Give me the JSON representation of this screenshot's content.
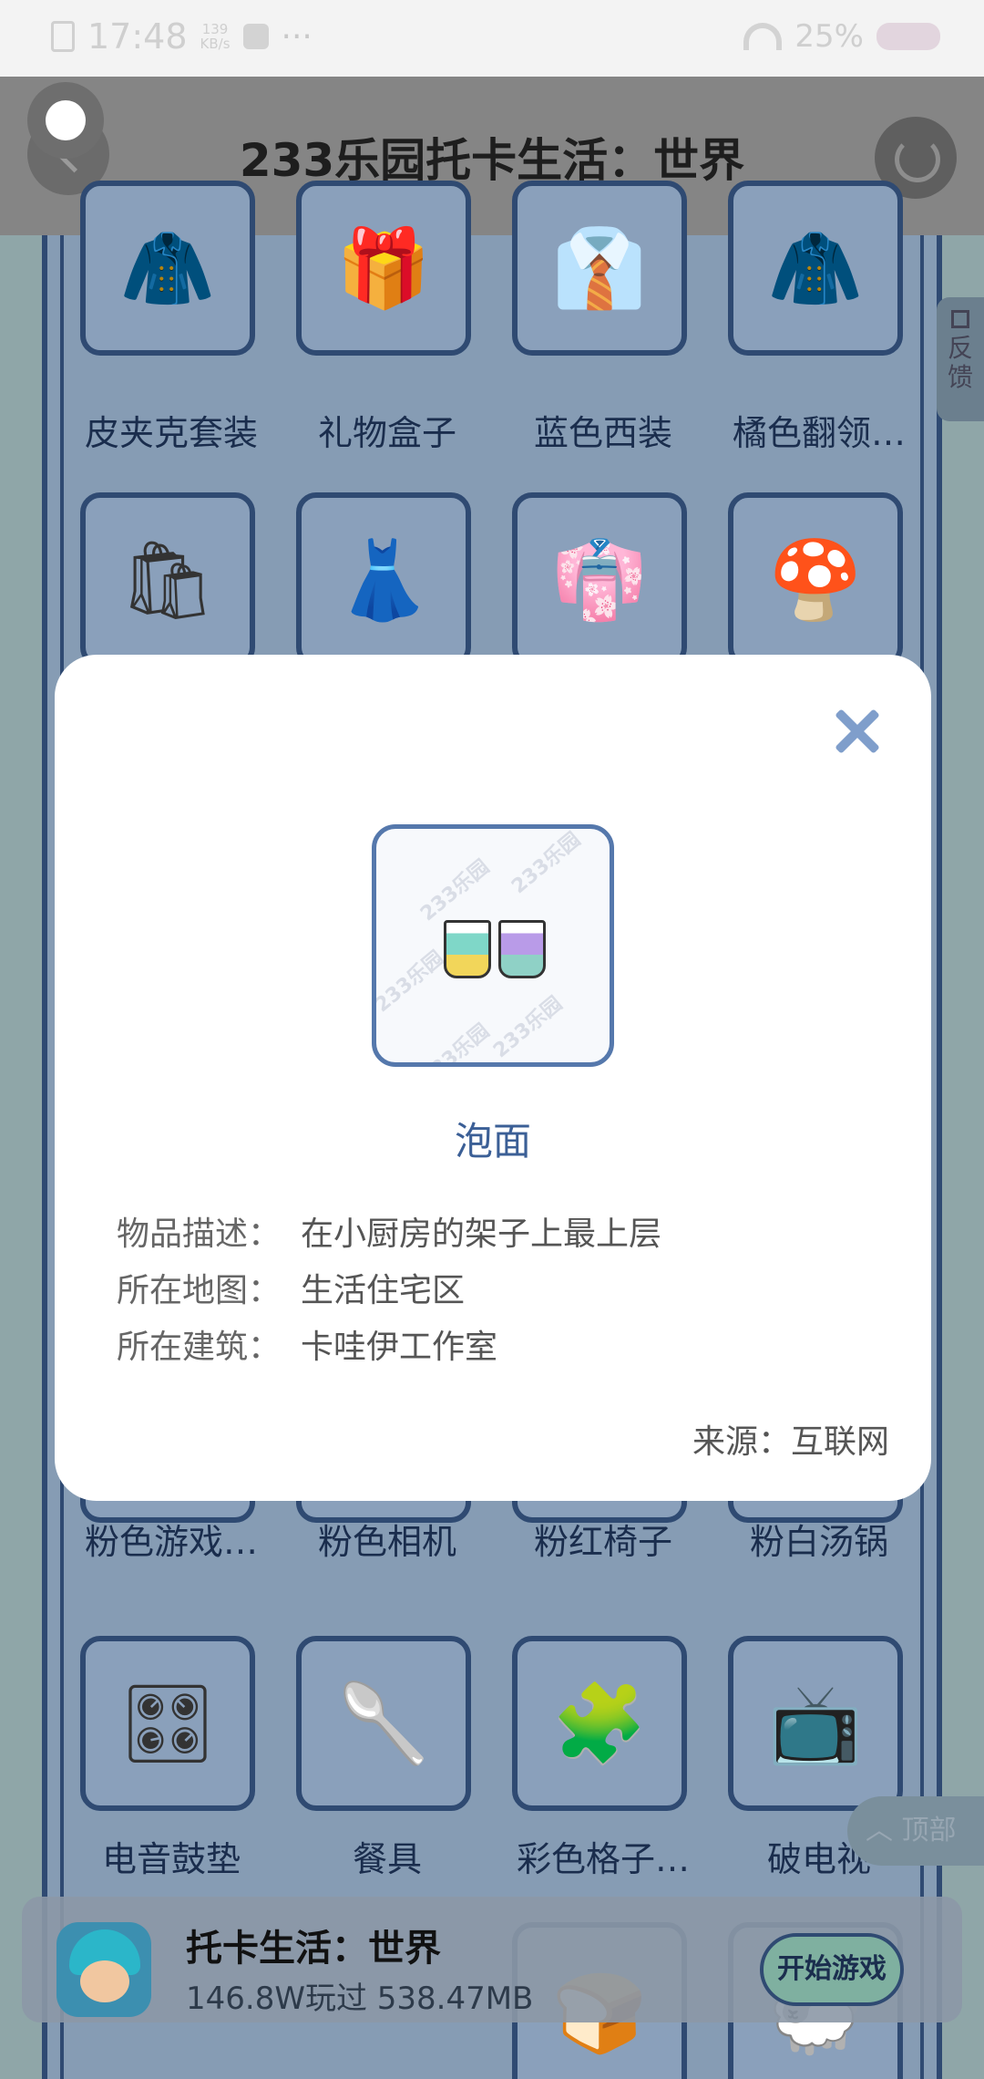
{
  "status_bar": {
    "time": "17:48",
    "speed_value": "139",
    "speed_unit": "KB/s",
    "more": "···",
    "battery": "25%"
  },
  "header": {
    "title": "233乐园托卡生活：世界"
  },
  "grid": {
    "row1": [
      "皮夹克套装",
      "礼物盒子",
      "蓝色西装",
      "橘色翻领…"
    ],
    "row4": [
      "粉色游戏…",
      "粉色相机",
      "粉红椅子",
      "粉白汤锅"
    ],
    "row5": [
      "电音鼓垫",
      "餐具",
      "彩色格子…",
      "破电视"
    ]
  },
  "feedback": {
    "label_1": "反",
    "label_2": "馈"
  },
  "to_top": {
    "label": "︿ 顶部"
  },
  "modal": {
    "item_name": "泡面",
    "watermark": "233乐园",
    "description_label": "物品描述：",
    "description_value": "在小厨房的架子上最上层",
    "map_label": "所在地图：",
    "map_value": "生活住宅区",
    "building_label": "所在建筑：",
    "building_value": "卡哇伊工作室",
    "source": "来源：互联网"
  },
  "bottom_bar": {
    "game_title": "托卡生活：世界",
    "stats": "146.8W玩过  538.47MB",
    "start_button": "开始游戏"
  }
}
